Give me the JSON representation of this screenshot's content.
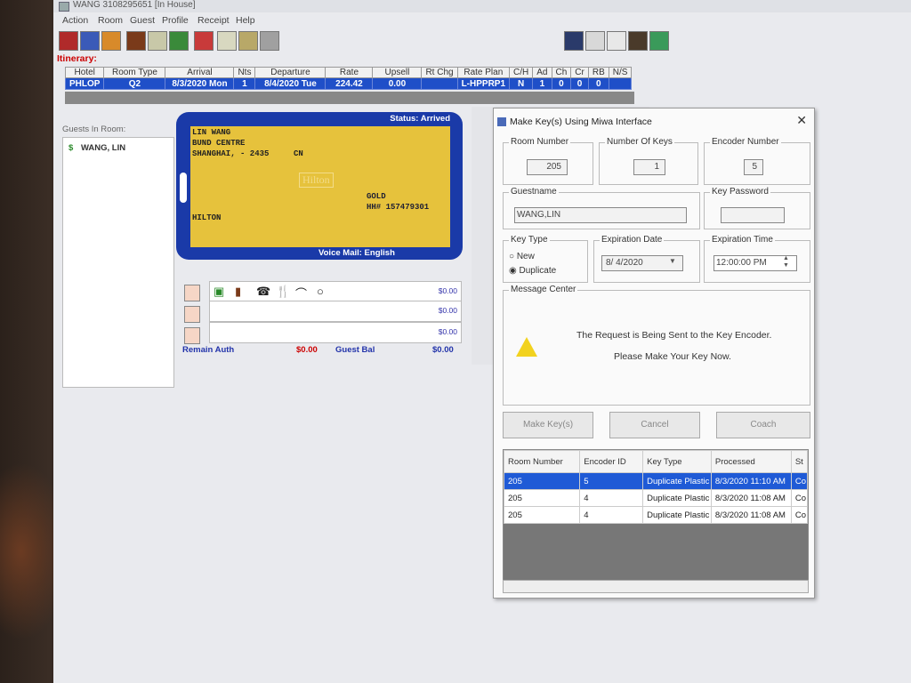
{
  "window": {
    "title": "WANG 3108295651 [In House]"
  },
  "menu": [
    "Action",
    "Room",
    "Guest",
    "Profile",
    "Receipt",
    "Help"
  ],
  "itinerary": {
    "label": "Itinerary:",
    "headers": [
      "Hotel",
      "Room Type",
      "Arrival",
      "Nts",
      "Departure",
      "Rate",
      "Upsell",
      "Rt Chg",
      "Rate Plan",
      "C/H",
      "Ad",
      "Ch",
      "Cr",
      "RB",
      "N/S"
    ],
    "row": [
      "PHLOP",
      "Q2",
      "8/3/2020 Mon",
      "1",
      "8/4/2020 Tue",
      "224.42",
      "0.00",
      "",
      "L-HPPRP1",
      "N",
      "1",
      "0",
      "0",
      "0",
      ""
    ]
  },
  "guests": {
    "label": "Guests In Room:",
    "items": [
      {
        "icon": "dollar-icon",
        "name": "WANG, LIN"
      }
    ]
  },
  "card": {
    "status": "Status: Arrived",
    "name": "LIN WANG",
    "address1": "BUND CENTRE",
    "address2": "SHANGHAI, -  2435",
    "country": "CN",
    "brand_logo": "Hilton",
    "tier": "GOLD",
    "hh_number": "HH# 157479301",
    "brand": "HILTON",
    "voicemail": "Voice Mail: English"
  },
  "folio": {
    "amounts": [
      "$0.00",
      "$0.00",
      "$0.00"
    ],
    "remain_auth_label": "Remain Auth",
    "remain_auth_value": "$0.00",
    "guest_bal_label": "Guest Bal",
    "guest_bal_value": "$0.00"
  },
  "dialog": {
    "title": "Make Key(s) Using Miwa Interface",
    "room_number_label": "Room Number",
    "room_number": "205",
    "num_keys_label": "Number Of Keys",
    "num_keys": "1",
    "encoder_label": "Encoder Number",
    "encoder": "5",
    "guestname_label": "Guestname",
    "guestname": "WANG,LIN",
    "key_password_label": "Key Password",
    "key_type_label": "Key Type",
    "key_type_new": "New",
    "key_type_duplicate": "Duplicate",
    "expiration_date_label": "Expiration Date",
    "expiration_date": "8/ 4/2020",
    "expiration_time_label": "Expiration Time",
    "expiration_time": "12:00:00 PM",
    "message_center_label": "Message Center",
    "message_line1": "The Request is Being Sent to the Key Encoder.",
    "message_line2": "Please Make Your Key Now.",
    "buttons": {
      "make": "Make Key(s)",
      "cancel": "Cancel",
      "coach": "Coach"
    },
    "grid_headers": [
      "Room Number",
      "Encoder ID",
      "Key Type",
      "Processed",
      "St"
    ],
    "grid_rows": [
      [
        "205",
        "5",
        "Duplicate Plastic",
        "8/3/2020 11:10 AM",
        "Co"
      ],
      [
        "205",
        "4",
        "Duplicate Plastic",
        "8/3/2020 11:08 AM",
        "Co"
      ],
      [
        "205",
        "4",
        "Duplicate Plastic",
        "8/3/2020 11:08 AM",
        "Co"
      ]
    ]
  },
  "colors": {
    "card_blue": "#1a3aa8",
    "card_gold": "#e6c23c",
    "selection_blue": "#1f5ad6",
    "itinerary_red": "#cc0000"
  }
}
